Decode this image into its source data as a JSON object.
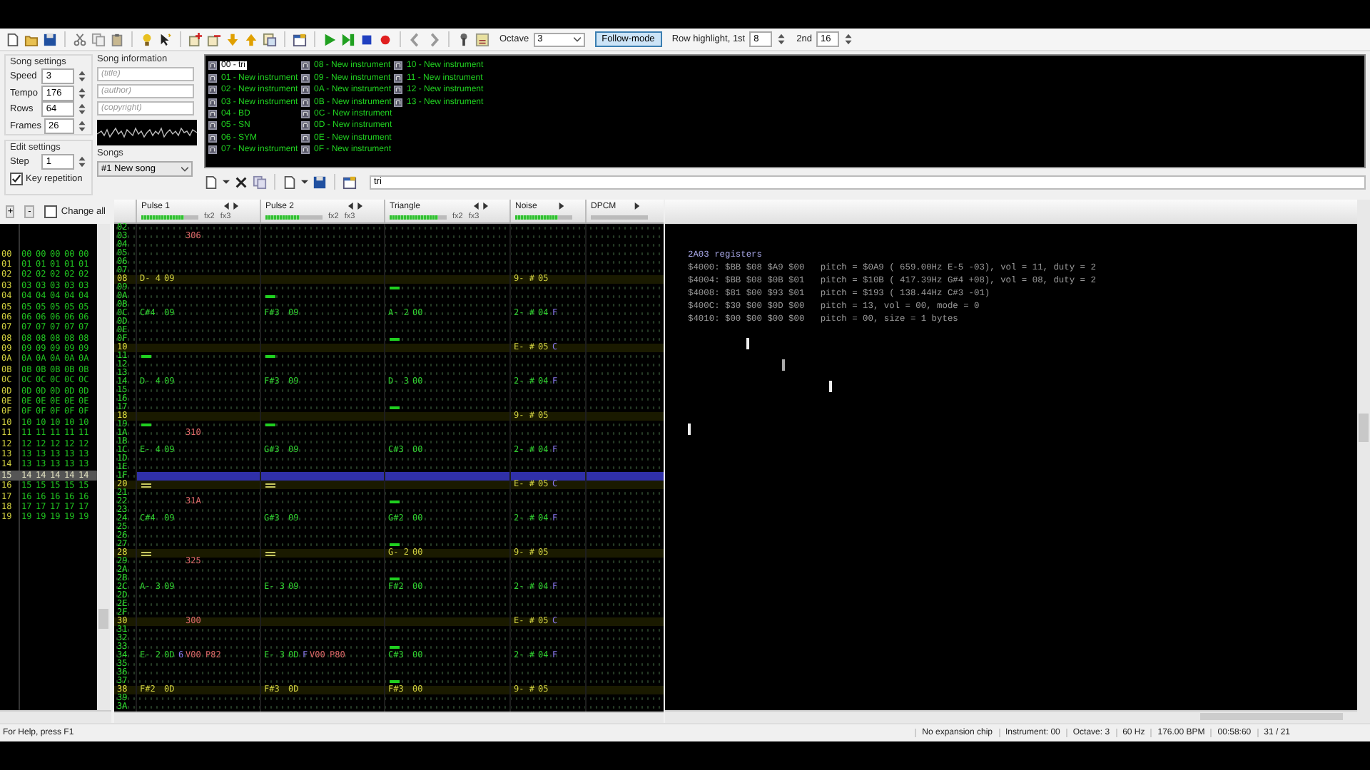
{
  "toolbar": {
    "octave_label": "Octave",
    "octave": "3",
    "follow_mode": {
      "label": "Follow-mode",
      "on": true
    },
    "row_highlight_label": "Row highlight, 1st",
    "highlight_1st": "8",
    "second_label": "2nd",
    "highlight_2nd": "16"
  },
  "song_settings": {
    "title": "Song settings",
    "fields": [
      {
        "label": "Speed",
        "value": "3"
      },
      {
        "label": "Tempo",
        "value": "176"
      },
      {
        "label": "Rows",
        "value": "64"
      },
      {
        "label": "Frames",
        "value": "26"
      }
    ]
  },
  "edit_settings": {
    "title": "Edit settings",
    "step_label": "Step",
    "step": "1",
    "key_repetition": {
      "label": "Key repetition",
      "checked": true
    }
  },
  "song_information": {
    "title": "Song information",
    "fields": [
      {
        "placeholder": "(title)"
      },
      {
        "placeholder": "(author)"
      },
      {
        "placeholder": "(copyright)"
      }
    ]
  },
  "songs": {
    "label": "Songs",
    "value": "#1 New song"
  },
  "instruments": [
    {
      "name": "00 - tri",
      "selected": true
    },
    {
      "name": "01 - New instrument",
      "selected": false
    },
    {
      "name": "02 - New instrument",
      "selected": false
    },
    {
      "name": "03 - New instrument",
      "selected": false
    },
    {
      "name": "04 - BD",
      "selected": false
    },
    {
      "name": "05 - SN",
      "selected": false
    },
    {
      "name": "06 - SYM",
      "selected": false
    },
    {
      "name": "07 - New instrument",
      "selected": false
    },
    {
      "name": "08 - New instrument",
      "selected": false
    },
    {
      "name": "09 - New instrument",
      "selected": false
    },
    {
      "name": "0A - New instrument",
      "selected": false
    },
    {
      "name": "0B - New instrument",
      "selected": false
    },
    {
      "name": "0C - New instrument",
      "selected": false
    },
    {
      "name": "0D - New instrument",
      "selected": false
    },
    {
      "name": "0E - New instrument",
      "selected": false
    },
    {
      "name": "0F - New instrument",
      "selected": false
    },
    {
      "name": "10 - New instrument",
      "selected": false
    },
    {
      "name": "11 - New instrument",
      "selected": false
    },
    {
      "name": "12 - New instrument",
      "selected": false
    },
    {
      "name": "13 - New instrument",
      "selected": false
    }
  ],
  "instrument_name": "tri",
  "frames": {
    "add": "+",
    "remove": "-",
    "change_all": {
      "label": "Change all",
      "checked": false
    },
    "rows": [
      {
        "row": "00",
        "values": [
          "00",
          "00",
          "00",
          "00",
          "00"
        ],
        "selected": false
      },
      {
        "row": "01",
        "values": [
          "01",
          "01",
          "01",
          "01",
          "01"
        ],
        "selected": false
      },
      {
        "row": "02",
        "values": [
          "02",
          "02",
          "02",
          "02",
          "02"
        ],
        "selected": false
      },
      {
        "row": "03",
        "values": [
          "03",
          "03",
          "03",
          "03",
          "03"
        ],
        "selected": false
      },
      {
        "row": "04",
        "values": [
          "04",
          "04",
          "04",
          "04",
          "04"
        ],
        "selected": false
      },
      {
        "row": "05",
        "values": [
          "05",
          "05",
          "05",
          "05",
          "05"
        ],
        "selected": false
      },
      {
        "row": "06",
        "values": [
          "06",
          "06",
          "06",
          "06",
          "06"
        ],
        "selected": false
      },
      {
        "row": "07",
        "values": [
          "07",
          "07",
          "07",
          "07",
          "07"
        ],
        "selected": false
      },
      {
        "row": "08",
        "values": [
          "08",
          "08",
          "08",
          "08",
          "08"
        ],
        "selected": false
      },
      {
        "row": "09",
        "values": [
          "09",
          "09",
          "09",
          "09",
          "09"
        ],
        "selected": false
      },
      {
        "row": "0A",
        "values": [
          "0A",
          "0A",
          "0A",
          "0A",
          "0A"
        ],
        "selected": false
      },
      {
        "row": "0B",
        "values": [
          "0B",
          "0B",
          "0B",
          "0B",
          "0B"
        ],
        "selected": false
      },
      {
        "row": "0C",
        "values": [
          "0C",
          "0C",
          "0C",
          "0C",
          "0C"
        ],
        "selected": false
      },
      {
        "row": "0D",
        "values": [
          "0D",
          "0D",
          "0D",
          "0D",
          "0D"
        ],
        "selected": false
      },
      {
        "row": "0E",
        "values": [
          "0E",
          "0E",
          "0E",
          "0E",
          "0E"
        ],
        "selected": false
      },
      {
        "row": "0F",
        "values": [
          "0F",
          "0F",
          "0F",
          "0F",
          "0F"
        ],
        "selected": false
      },
      {
        "row": "10",
        "values": [
          "10",
          "10",
          "10",
          "10",
          "10"
        ],
        "selected": false
      },
      {
        "row": "11",
        "values": [
          "11",
          "11",
          "11",
          "11",
          "11"
        ],
        "selected": false
      },
      {
        "row": "12",
        "values": [
          "12",
          "12",
          "12",
          "12",
          "12"
        ],
        "selected": false
      },
      {
        "row": "13",
        "values": [
          "13",
          "13",
          "13",
          "13",
          "13"
        ],
        "selected": false
      },
      {
        "row": "14",
        "values": [
          "13",
          "13",
          "13",
          "13",
          "13"
        ],
        "selected": false
      },
      {
        "row": "15",
        "values": [
          "14",
          "14",
          "14",
          "14",
          "14"
        ],
        "selected": true
      },
      {
        "row": "16",
        "values": [
          "15",
          "15",
          "15",
          "15",
          "15"
        ],
        "selected": false
      },
      {
        "row": "17",
        "values": [
          "16",
          "16",
          "16",
          "16",
          "16"
        ],
        "selected": false
      },
      {
        "row": "18",
        "values": [
          "17",
          "17",
          "17",
          "17",
          "17"
        ],
        "selected": false
      },
      {
        "row": "19",
        "values": [
          "19",
          "19",
          "19",
          "19",
          "19"
        ],
        "selected": false
      }
    ]
  },
  "channels": [
    {
      "name": "Pulse 1",
      "level": 0.75,
      "effect_columns": [
        "fx2",
        "fx3"
      ]
    },
    {
      "name": "Pulse 2",
      "level": 0.6,
      "effect_columns": [
        "fx2",
        "fx3"
      ]
    },
    {
      "name": "Triangle",
      "level": 0.85,
      "effect_columns": [
        "fx2",
        "fx3"
      ]
    },
    {
      "name": "Noise",
      "level": 0.75
    },
    {
      "name": "DPCM",
      "level": 0
    }
  ],
  "pattern_rows": [
    {
      "row": "02",
      "highlighted": false,
      "selected": false
    },
    {
      "row": "03",
      "highlighted": false,
      "selected": false,
      "pulse_1": {
        "kind": "effect",
        "effects": [
          "306"
        ]
      }
    },
    {
      "row": "04",
      "highlighted": false,
      "selected": false
    },
    {
      "row": "05",
      "highlighted": false,
      "selected": false
    },
    {
      "row": "06",
      "highlighted": false,
      "selected": false
    },
    {
      "row": "07",
      "highlighted": false,
      "selected": false
    },
    {
      "row": "08",
      "highlighted": true,
      "selected": false,
      "pulse_1": {
        "kind": "note",
        "note": "D- 4",
        "instrument": "09"
      },
      "noise": {
        "kind": "note",
        "note": "9- #",
        "instrument": "05"
      }
    },
    {
      "row": "09",
      "highlighted": false,
      "selected": false,
      "triangle": {
        "kind": "off"
      }
    },
    {
      "row": "0A",
      "highlighted": false,
      "selected": false,
      "pulse_2": {
        "kind": "off"
      }
    },
    {
      "row": "0B",
      "highlighted": false,
      "selected": false
    },
    {
      "row": "0C",
      "highlighted": false,
      "selected": false,
      "pulse_1": {
        "kind": "note",
        "note": "C#4",
        "instrument": "09"
      },
      "pulse_2": {
        "kind": "note",
        "note": "F#3",
        "instrument": "09"
      },
      "triangle": {
        "kind": "note",
        "note": "A- 2",
        "instrument": "00"
      },
      "noise": {
        "kind": "note",
        "note": "2- #",
        "instrument": "04",
        "volume": "F"
      }
    },
    {
      "row": "0D",
      "highlighted": false,
      "selected": false
    },
    {
      "row": "0E",
      "highlighted": false,
      "selected": false
    },
    {
      "row": "0F",
      "highlighted": false,
      "selected": false,
      "triangle": {
        "kind": "off"
      }
    },
    {
      "row": "10",
      "highlighted": true,
      "selected": false,
      "noise": {
        "kind": "note",
        "note": "E- #",
        "instrument": "05",
        "volume": "C"
      }
    },
    {
      "row": "11",
      "highlighted": false,
      "selected": false,
      "pulse_1": {
        "kind": "off"
      },
      "pulse_2": {
        "kind": "off"
      }
    },
    {
      "row": "12",
      "highlighted": false,
      "selected": false
    },
    {
      "row": "13",
      "highlighted": false,
      "selected": false
    },
    {
      "row": "14",
      "highlighted": false,
      "selected": false,
      "pulse_1": {
        "kind": "note",
        "note": "D- 4",
        "instrument": "09"
      },
      "pulse_2": {
        "kind": "note",
        "note": "F#3",
        "instrument": "09"
      },
      "triangle": {
        "kind": "note",
        "note": "D- 3",
        "instrument": "00"
      },
      "noise": {
        "kind": "note",
        "note": "2- #",
        "instrument": "04",
        "volume": "F"
      }
    },
    {
      "row": "15",
      "highlighted": false,
      "selected": false
    },
    {
      "row": "16",
      "highlighted": false,
      "selected": false
    },
    {
      "row": "17",
      "highlighted": false,
      "selected": false,
      "triangle": {
        "kind": "off"
      }
    },
    {
      "row": "18",
      "highlighted": true,
      "selected": false,
      "noise": {
        "kind": "note",
        "note": "9- #",
        "instrument": "05"
      }
    },
    {
      "row": "19",
      "highlighted": false,
      "selected": false,
      "pulse_1": {
        "kind": "off"
      },
      "pulse_2": {
        "kind": "off"
      }
    },
    {
      "row": "1A",
      "highlighted": false,
      "selected": false,
      "pulse_1": {
        "kind": "effect",
        "effects": [
          "310"
        ]
      }
    },
    {
      "row": "1B",
      "highlighted": false,
      "selected": false
    },
    {
      "row": "1C",
      "highlighted": false,
      "selected": false,
      "pulse_1": {
        "kind": "note",
        "note": "E- 4",
        "instrument": "09"
      },
      "pulse_2": {
        "kind": "note",
        "note": "G#3",
        "instrument": "09"
      },
      "triangle": {
        "kind": "note",
        "note": "C#3",
        "instrument": "00"
      },
      "noise": {
        "kind": "note",
        "note": "2- #",
        "instrument": "04",
        "volume": "F"
      }
    },
    {
      "row": "1D",
      "highlighted": false,
      "selected": false
    },
    {
      "row": "1E",
      "highlighted": false,
      "selected": false
    },
    {
      "row": "1F",
      "highlighted": false,
      "selected": true
    },
    {
      "row": "20",
      "highlighted": true,
      "selected": false,
      "pulse_1": {
        "kind": "release"
      },
      "pulse_2": {
        "kind": "release"
      },
      "noise": {
        "kind": "note",
        "note": "E- #",
        "instrument": "05",
        "volume": "C"
      }
    },
    {
      "row": "21",
      "highlighted": false,
      "selected": false
    },
    {
      "row": "22",
      "highlighted": false,
      "selected": false,
      "pulse_1": {
        "kind": "effect",
        "effects": [
          "31A"
        ]
      },
      "triangle": {
        "kind": "off"
      }
    },
    {
      "row": "23",
      "highlighted": false,
      "selected": false
    },
    {
      "row": "24",
      "highlighted": false,
      "selected": false,
      "pulse_1": {
        "kind": "note",
        "note": "C#4",
        "instrument": "09"
      },
      "pulse_2": {
        "kind": "note",
        "note": "G#3",
        "instrument": "09"
      },
      "triangle": {
        "kind": "note",
        "note": "G#2",
        "instrument": "00"
      },
      "noise": {
        "kind": "note",
        "note": "2- #",
        "instrument": "04",
        "volume": "F"
      }
    },
    {
      "row": "25",
      "highlighted": false,
      "selected": false
    },
    {
      "row": "26",
      "highlighted": false,
      "selected": false
    },
    {
      "row": "27",
      "highlighted": false,
      "selected": false,
      "triangle": {
        "kind": "off"
      }
    },
    {
      "row": "28",
      "highlighted": true,
      "selected": false,
      "pulse_1": {
        "kind": "release"
      },
      "pulse_2": {
        "kind": "release"
      },
      "triangle": {
        "kind": "note",
        "note": "G- 2",
        "instrument": "00"
      },
      "noise": {
        "kind": "note",
        "note": "9- #",
        "instrument": "05"
      }
    },
    {
      "row": "29",
      "highlighted": false,
      "selected": false,
      "pulse_1": {
        "kind": "effect",
        "effects": [
          "325"
        ]
      }
    },
    {
      "row": "2A",
      "highlighted": false,
      "selected": false
    },
    {
      "row": "2B",
      "highlighted": false,
      "selected": false,
      "triangle": {
        "kind": "off"
      }
    },
    {
      "row": "2C",
      "highlighted": false,
      "selected": false,
      "pulse_1": {
        "kind": "note",
        "note": "A- 3",
        "instrument": "09"
      },
      "pulse_2": {
        "kind": "note",
        "note": "E- 3",
        "instrument": "09"
      },
      "triangle": {
        "kind": "note",
        "note": "F#2",
        "instrument": "00"
      },
      "noise": {
        "kind": "note",
        "note": "2- #",
        "instrument": "04",
        "volume": "F"
      }
    },
    {
      "row": "2D",
      "highlighted": false,
      "selected": false
    },
    {
      "row": "2E",
      "highlighted": false,
      "selected": false
    },
    {
      "row": "2F",
      "highlighted": false,
      "selected": false
    },
    {
      "row": "30",
      "highlighted": true,
      "selected": false,
      "pulse_1": {
        "kind": "effect",
        "effects": [
          "300"
        ]
      },
      "noise": {
        "kind": "note",
        "note": "E- #",
        "instrument": "05",
        "volume": "C"
      }
    },
    {
      "row": "31",
      "highlighted": false,
      "selected": false
    },
    {
      "row": "32",
      "highlighted": false,
      "selected": false
    },
    {
      "row": "33",
      "highlighted": false,
      "selected": false,
      "triangle": {
        "kind": "off"
      }
    },
    {
      "row": "34",
      "highlighted": false,
      "selected": false,
      "pulse_1": {
        "kind": "note",
        "note": "E- 2",
        "instrument": "0D",
        "volume": "6",
        "effects": [
          "V00",
          "P82"
        ]
      },
      "pulse_2": {
        "kind": "note",
        "note": "E- 3",
        "instrument": "0D",
        "volume": "F",
        "effects": [
          "V00",
          "P80"
        ]
      },
      "triangle": {
        "kind": "note",
        "note": "C#3",
        "instrument": "00"
      },
      "noise": {
        "kind": "note",
        "note": "2- #",
        "instrument": "04",
        "volume": "F"
      }
    },
    {
      "row": "35",
      "highlighted": false,
      "selected": false
    },
    {
      "row": "36",
      "highlighted": false,
      "selected": false
    },
    {
      "row": "37",
      "highlighted": false,
      "selected": false,
      "triangle": {
        "kind": "off"
      }
    },
    {
      "row": "38",
      "highlighted": true,
      "selected": false,
      "pulse_1": {
        "kind": "note",
        "note": "F#2",
        "instrument": "0D"
      },
      "pulse_2": {
        "kind": "note",
        "note": "F#3",
        "instrument": "0D"
      },
      "triangle": {
        "kind": "note",
        "note": "F#3",
        "instrument": "00"
      },
      "noise": {
        "kind": "note",
        "note": "9- #",
        "instrument": "05"
      }
    },
    {
      "row": "39",
      "highlighted": false,
      "selected": false
    },
    {
      "row": "3A",
      "highlighted": false,
      "selected": false
    }
  ],
  "registers": {
    "title": "2A03 registers",
    "lines": [
      "$4000: $BB $08 $A9 $00   pitch = $0A9 ( 659.00Hz E-5 -03), vol = 11, duty = 2",
      "$4004: $BB $08 $0B $01   pitch = $10B ( 417.39Hz G#4 +08), vol = 08, duty = 2",
      "$4008: $81 $00 $93 $01   pitch = $193 ( 138.44Hz C#3 -01)",
      "$400C: $30 $00 $0D $00   pitch = 13, vol = 00, mode = 0",
      "$4010: $00 $00 $00 $00   pitch = 00, size = 1 bytes"
    ]
  },
  "status_bar": {
    "help": "For Help, press F1",
    "fields": [
      "No expansion chip",
      "Instrument: 00",
      "Octave: 3",
      "60 Hz",
      "176.00 BPM",
      "00:58:60",
      "31 / 21"
    ]
  }
}
